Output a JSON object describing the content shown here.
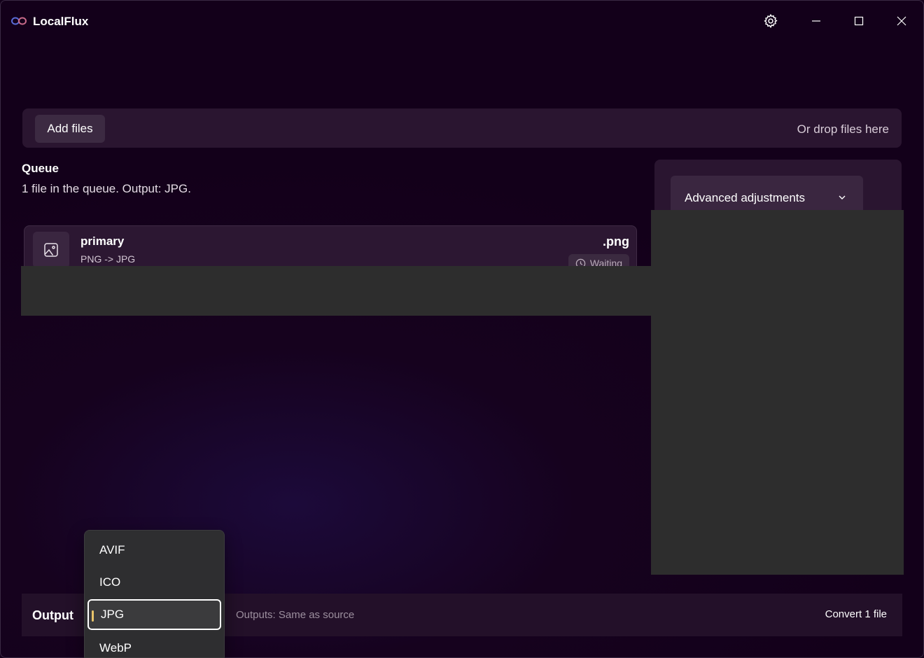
{
  "app": {
    "title": "LocalFlux",
    "logo_icon": "infinity-logo-icon"
  },
  "titlebar": {
    "settings_icon": "gear-icon",
    "minimize_icon": "minimize-icon",
    "maximize_icon": "maximize-icon",
    "close_icon": "close-icon"
  },
  "dropzone": {
    "add_files_label": "Add files",
    "drop_hint": "Or drop files here"
  },
  "queue": {
    "title": "Queue",
    "summary": "1 file in the queue. Output: JPG.",
    "items": [
      {
        "name": "primary",
        "conversion": "PNG -> JPG",
        "extension": ".png",
        "status": "Waiting",
        "icon": "image-file-icon",
        "status_icon": "clock-icon"
      }
    ]
  },
  "advanced": {
    "label": "Advanced adjustments",
    "chevron_icon": "chevron-down-icon"
  },
  "output": {
    "label": "Output",
    "destination": "Outputs: Same as source",
    "convert_label": "Convert 1 file",
    "formats": [
      "AVIF",
      "ICO",
      "JPG",
      "WebP"
    ],
    "selected_format": "JPG"
  },
  "colors": {
    "background": "#16021e",
    "panel": "#2a1530",
    "selection_accent": "#e8c46a",
    "redaction": "#2d2d2d"
  }
}
